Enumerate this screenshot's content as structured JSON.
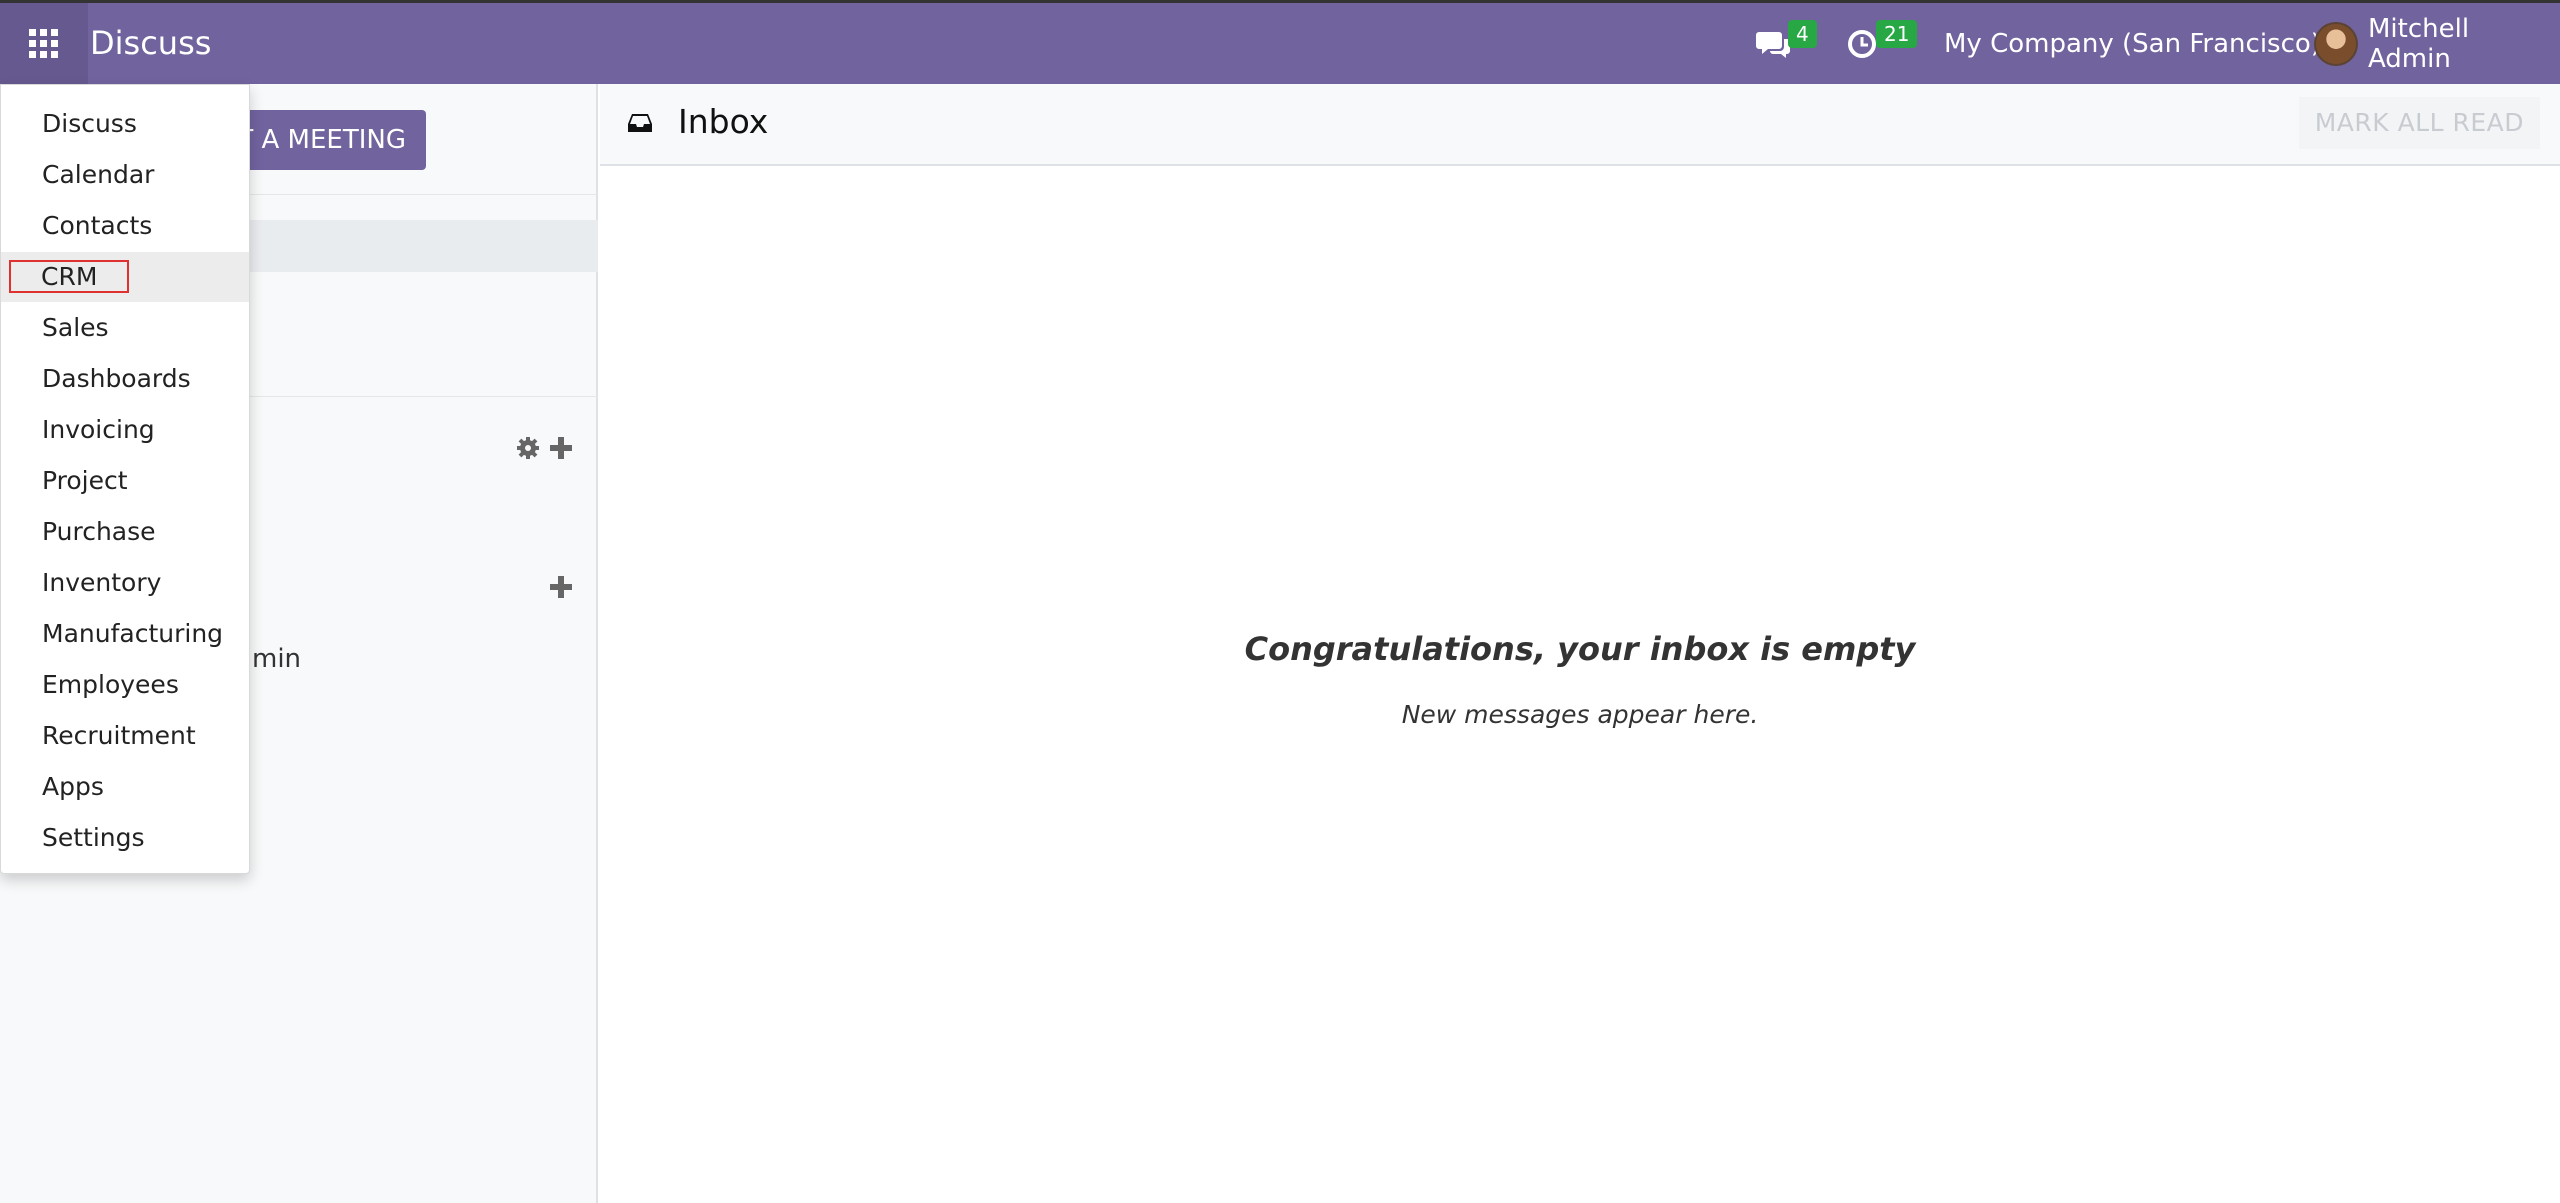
{
  "navbar": {
    "app_title": "Discuss",
    "messages_badge": "4",
    "activities_badge": "21",
    "company": "My Company (San Francisco)",
    "user_name": "Mitchell Admin"
  },
  "sidebar": {
    "start_meeting_label": "T A MEETING",
    "partial_user_text": "min"
  },
  "main": {
    "title": "Inbox",
    "mark_all_read": "MARK ALL READ",
    "empty_title": "Congratulations, your inbox is empty",
    "empty_subtitle": "New messages appear here."
  },
  "apps_menu": {
    "items": [
      {
        "label": "Discuss"
      },
      {
        "label": "Calendar"
      },
      {
        "label": "Contacts"
      },
      {
        "label": "CRM"
      },
      {
        "label": "Sales"
      },
      {
        "label": "Dashboards"
      },
      {
        "label": "Invoicing"
      },
      {
        "label": "Project"
      },
      {
        "label": "Purchase"
      },
      {
        "label": "Inventory"
      },
      {
        "label": "Manufacturing"
      },
      {
        "label": "Employees"
      },
      {
        "label": "Recruitment"
      },
      {
        "label": "Apps"
      },
      {
        "label": "Settings"
      }
    ]
  },
  "colors": {
    "navbar": "#71639e",
    "badge": "#28a745",
    "highlight": "#e03131"
  }
}
